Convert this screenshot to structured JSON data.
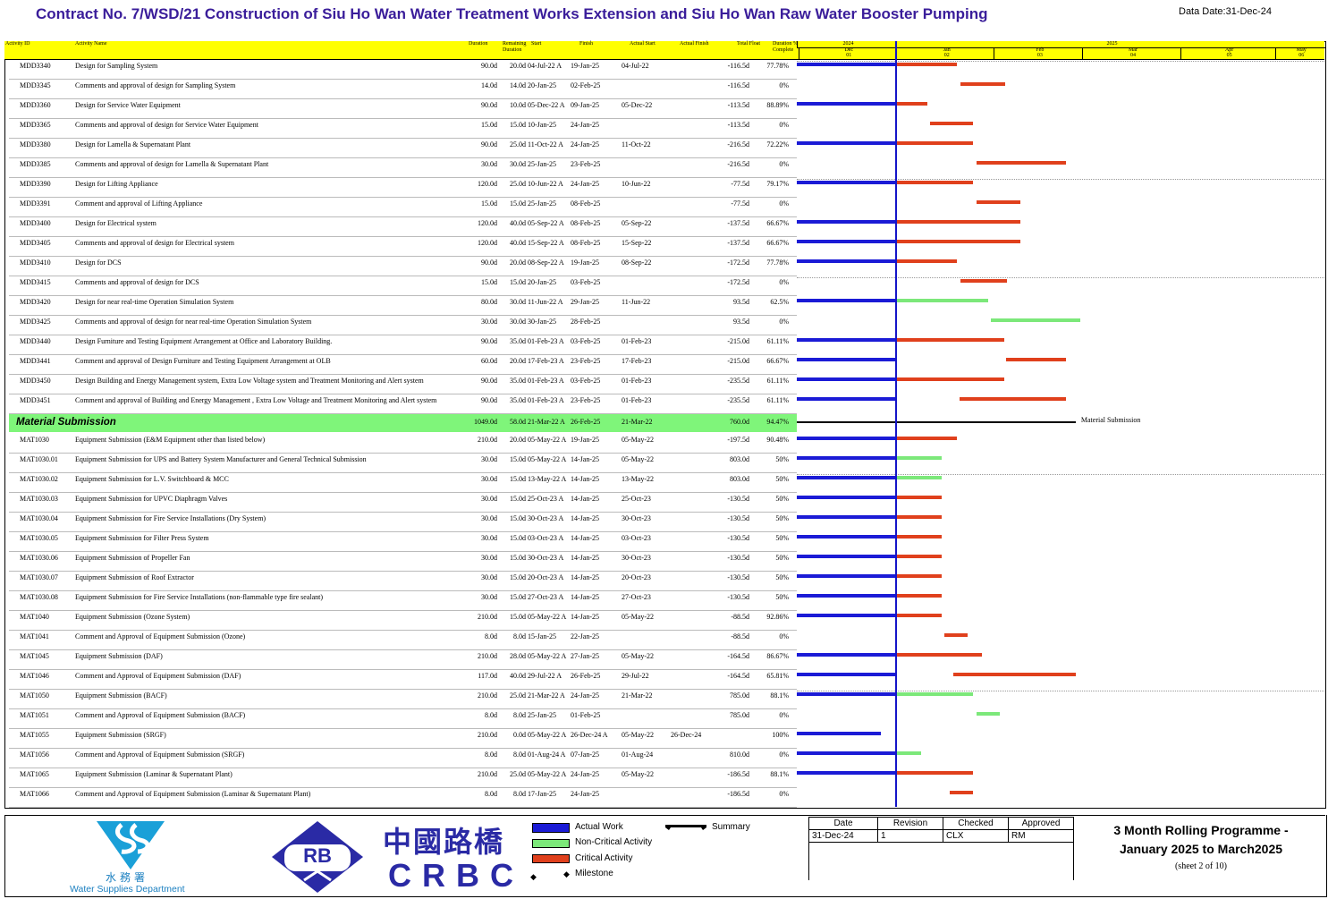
{
  "title": "Contract No. 7/WSD/21 Construction of Siu Ho Wan Water Treatment Works Extension and Siu Ho Wan Raw Water Booster Pumping",
  "data_date": "Data Date:31-Dec-24",
  "columns": {
    "activity_id": "Activity ID",
    "activity_name": "Activity Name",
    "duration": "Duration",
    "remaining": "Remaining Duration",
    "start": "Start",
    "finish": "Finish",
    "actual_start": "Actual Start",
    "actual_finish": "Actual Finish",
    "total_float": "Total Float",
    "complete": "Duration % Complete"
  },
  "timescale": {
    "years": [
      "2024",
      "2025"
    ],
    "months": [
      "Dec",
      "Jan",
      "Feb",
      "Mar",
      "Apr",
      "May"
    ],
    "periods": [
      "01",
      "02",
      "03",
      "04",
      "05",
      "06"
    ]
  },
  "colors": {
    "actual": "#1b1bd6",
    "critical": "#e0401c",
    "non_critical": "#7ce87a",
    "wbs_band": "#7ff57a",
    "header": "#ffff00",
    "title": "#3a1d9a"
  },
  "rows": [
    {
      "id": "MDD3340",
      "name": "Design for Sampling System",
      "dur": "90.0d",
      "rem": "20.0d",
      "start": "04-Jul-22 A",
      "finish": "19-Jan-25",
      "astart": "04-Jul-22",
      "afinish": "",
      "tf": "-116.5d",
      "pct": "77.78%",
      "actual": 1,
      "t_start": 0.0,
      "t_end": 0.63,
      "type": "crit"
    },
    {
      "id": "MDD3345",
      "name": "Comments and approval of design for Sampling System",
      "dur": "14.0d",
      "rem": "14.0d",
      "start": "20-Jan-25",
      "finish": "02-Feb-25",
      "astart": "",
      "afinish": "",
      "tf": "-116.5d",
      "pct": "0%",
      "actual": 0,
      "t_start": 0.67,
      "t_end": 1.13,
      "type": "crit"
    },
    {
      "id": "MDD3360",
      "name": "Design for Service Water Equipment",
      "dur": "90.0d",
      "rem": "10.0d",
      "start": "05-Dec-22 A",
      "finish": "09-Jan-25",
      "astart": "05-Dec-22",
      "afinish": "",
      "tf": "-113.5d",
      "pct": "88.89%",
      "actual": 1,
      "t_start": 0.0,
      "t_end": 0.32,
      "type": "crit"
    },
    {
      "id": "MDD3365",
      "name": "Comments and approval of design for Service Water Equipment",
      "dur": "15.0d",
      "rem": "15.0d",
      "start": "10-Jan-25",
      "finish": "24-Jan-25",
      "astart": "",
      "afinish": "",
      "tf": "-113.5d",
      "pct": "0%",
      "actual": 0,
      "t_start": 0.35,
      "t_end": 0.8,
      "type": "crit"
    },
    {
      "id": "MDD3380",
      "name": "Design for Lamella & Supernatant Plant",
      "dur": "90.0d",
      "rem": "25.0d",
      "start": "11-Oct-22 A",
      "finish": "24-Jan-25",
      "astart": "11-Oct-22",
      "afinish": "",
      "tf": "-216.5d",
      "pct": "72.22%",
      "actual": 1,
      "t_start": 0.0,
      "t_end": 0.8,
      "type": "crit"
    },
    {
      "id": "MDD3385",
      "name": "Comments and approval of design for Lamella & Supernatant Plant",
      "dur": "30.0d",
      "rem": "30.0d",
      "start": "25-Jan-25",
      "finish": "23-Feb-25",
      "astart": "",
      "afinish": "",
      "tf": "-216.5d",
      "pct": "0%",
      "actual": 0,
      "t_start": 0.83,
      "t_end": 1.76,
      "type": "crit"
    },
    {
      "id": "MDD3390",
      "name": "Design for Lifting Appliance",
      "dur": "120.0d",
      "rem": "25.0d",
      "start": "10-Jun-22 A",
      "finish": "24-Jan-25",
      "astart": "10-Jun-22",
      "afinish": "",
      "tf": "-77.5d",
      "pct": "79.17%",
      "actual": 1,
      "t_start": 0.0,
      "t_end": 0.8,
      "type": "crit"
    },
    {
      "id": "MDD3391",
      "name": "Comment and approval of Lifting Appliance",
      "dur": "15.0d",
      "rem": "15.0d",
      "start": "25-Jan-25",
      "finish": "08-Feb-25",
      "astart": "",
      "afinish": "",
      "tf": "-77.5d",
      "pct": "0%",
      "actual": 0,
      "t_start": 0.83,
      "t_end": 1.29,
      "type": "crit"
    },
    {
      "id": "MDD3400",
      "name": "Design for Electrical system",
      "dur": "120.0d",
      "rem": "40.0d",
      "start": "05-Sep-22 A",
      "finish": "08-Feb-25",
      "astart": "05-Sep-22",
      "afinish": "",
      "tf": "-137.5d",
      "pct": "66.67%",
      "actual": 1,
      "t_start": 0.0,
      "t_end": 1.29,
      "type": "crit"
    },
    {
      "id": "MDD3405",
      "name": "Comments and approval of design for Electrical system",
      "dur": "120.0d",
      "rem": "40.0d",
      "start": "15-Sep-22 A",
      "finish": "08-Feb-25",
      "astart": "15-Sep-22",
      "afinish": "",
      "tf": "-137.5d",
      "pct": "66.67%",
      "actual": 1,
      "t_start": 0.0,
      "t_end": 1.29,
      "type": "crit"
    },
    {
      "id": "MDD3410",
      "name": "Design for DCS",
      "dur": "90.0d",
      "rem": "20.0d",
      "start": "08-Sep-22 A",
      "finish": "19-Jan-25",
      "astart": "08-Sep-22",
      "afinish": "",
      "tf": "-172.5d",
      "pct": "77.78%",
      "actual": 1,
      "t_start": 0.0,
      "t_end": 0.63,
      "type": "crit"
    },
    {
      "id": "MDD3415",
      "name": "Comments and approval of design for DCS",
      "dur": "15.0d",
      "rem": "15.0d",
      "start": "20-Jan-25",
      "finish": "03-Feb-25",
      "astart": "",
      "afinish": "",
      "tf": "-172.5d",
      "pct": "0%",
      "actual": 0,
      "t_start": 0.67,
      "t_end": 1.15,
      "type": "crit"
    },
    {
      "id": "MDD3420",
      "name": "Design for near real-time Operation Simulation System",
      "dur": "80.0d",
      "rem": "30.0d",
      "start": "11-Jun-22 A",
      "finish": "29-Jan-25",
      "astart": "11-Jun-22",
      "afinish": "",
      "tf": "93.5d",
      "pct": "62.5%",
      "actual": 1,
      "t_start": 0.0,
      "t_end": 0.95,
      "type": "noncrit"
    },
    {
      "id": "MDD3425",
      "name": "Comments and approval of design for near real-time Operation Simulation System",
      "dur": "30.0d",
      "rem": "30.0d",
      "start": "30-Jan-25",
      "finish": "28-Feb-25",
      "astart": "",
      "afinish": "",
      "tf": "93.5d",
      "pct": "0%",
      "actual": 0,
      "t_start": 0.98,
      "t_end": 1.91,
      "type": "noncrit"
    },
    {
      "id": "MDD3440",
      "name": "Design Furniture and Testing Equipment Arrangement at Office and Laboratory Building.",
      "dur": "90.0d",
      "rem": "35.0d",
      "start": "01-Feb-23 A",
      "finish": "03-Feb-25",
      "astart": "01-Feb-23",
      "afinish": "",
      "tf": "-215.0d",
      "pct": "61.11%",
      "actual": 1,
      "t_start": 0.0,
      "t_end": 1.12,
      "type": "crit"
    },
    {
      "id": "MDD3441",
      "name": "Comment and approval of Design Furniture and Testing Equipment Arrangement at OLB",
      "dur": "60.0d",
      "rem": "20.0d",
      "start": "17-Feb-23 A",
      "finish": "23-Feb-25",
      "astart": "17-Feb-23",
      "afinish": "",
      "tf": "-215.0d",
      "pct": "66.67%",
      "actual": 1,
      "t_start": 1.14,
      "t_end": 1.76,
      "type": "crit"
    },
    {
      "id": "MDD3450",
      "name": "Design Building and Energy Management system, Extra Low Voltage system and Treatment Monitoring and Alert system",
      "dur": "90.0d",
      "rem": "35.0d",
      "start": "01-Feb-23 A",
      "finish": "03-Feb-25",
      "astart": "01-Feb-23",
      "afinish": "",
      "tf": "-235.5d",
      "pct": "61.11%",
      "actual": 1,
      "t_start": 0.0,
      "t_end": 1.12,
      "type": "crit"
    },
    {
      "id": "MDD3451",
      "name": "Comment and approval of Building and Energy Management , Extra Low Voltage and Treatment Monitoring and Alert system",
      "dur": "90.0d",
      "rem": "35.0d",
      "start": "01-Feb-23 A",
      "finish": "23-Feb-25",
      "astart": "01-Feb-23",
      "afinish": "",
      "tf": "-235.5d",
      "pct": "61.11%",
      "actual": 1,
      "t_start": 0.66,
      "t_end": 1.76,
      "type": "crit"
    },
    {
      "wbs": true,
      "name": "Material Submission",
      "dur": "1049.0d",
      "rem": "58.0d",
      "start": "21-Mar-22 A",
      "finish": "26-Feb-25",
      "astart": "21-Mar-22",
      "afinish": "",
      "tf": "760.0d",
      "pct": "94.47%",
      "label": "Material Submission"
    },
    {
      "id": "MAT1030",
      "name": "Equipment Submission (E&M Equipment other than listed below)",
      "dur": "210.0d",
      "rem": "20.0d",
      "start": "05-May-22 A",
      "finish": "19-Jan-25",
      "astart": "05-May-22",
      "afinish": "",
      "tf": "-197.5d",
      "pct": "90.48%",
      "actual": 1,
      "t_start": 0.0,
      "t_end": 0.63,
      "type": "crit"
    },
    {
      "id": "MAT1030.01",
      "name": "Equipment Submission for UPS and Battery System Manufacturer and General Technical Submission",
      "dur": "30.0d",
      "rem": "15.0d",
      "start": "05-May-22 A",
      "finish": "14-Jan-25",
      "astart": "05-May-22",
      "afinish": "",
      "tf": "803.0d",
      "pct": "50%",
      "actual": 1,
      "t_start": 0.0,
      "t_end": 0.47,
      "type": "noncrit"
    },
    {
      "id": "MAT1030.02",
      "name": "Equipment Submission for L.V. Switchboard & MCC",
      "dur": "30.0d",
      "rem": "15.0d",
      "start": "13-May-22 A",
      "finish": "14-Jan-25",
      "astart": "13-May-22",
      "afinish": "",
      "tf": "803.0d",
      "pct": "50%",
      "actual": 1,
      "t_start": 0.0,
      "t_end": 0.47,
      "type": "noncrit"
    },
    {
      "id": "MAT1030.03",
      "name": "Equipment Submission for UPVC Diaphragm Valves",
      "dur": "30.0d",
      "rem": "15.0d",
      "start": "25-Oct-23 A",
      "finish": "14-Jan-25",
      "astart": "25-Oct-23",
      "afinish": "",
      "tf": "-130.5d",
      "pct": "50%",
      "actual": 1,
      "t_start": 0.0,
      "t_end": 0.47,
      "type": "crit"
    },
    {
      "id": "MAT1030.04",
      "name": "Equipment Submission for Fire Service Installations (Dry System)",
      "dur": "30.0d",
      "rem": "15.0d",
      "start": "30-Oct-23 A",
      "finish": "14-Jan-25",
      "astart": "30-Oct-23",
      "afinish": "",
      "tf": "-130.5d",
      "pct": "50%",
      "actual": 1,
      "t_start": 0.0,
      "t_end": 0.47,
      "type": "crit"
    },
    {
      "id": "MAT1030.05",
      "name": "Equipment Submission for Filter Press System",
      "dur": "30.0d",
      "rem": "15.0d",
      "start": "03-Oct-23 A",
      "finish": "14-Jan-25",
      "astart": "03-Oct-23",
      "afinish": "",
      "tf": "-130.5d",
      "pct": "50%",
      "actual": 1,
      "t_start": 0.0,
      "t_end": 0.47,
      "type": "crit"
    },
    {
      "id": "MAT1030.06",
      "name": "Equipment Submission of Propeller Fan",
      "dur": "30.0d",
      "rem": "15.0d",
      "start": "30-Oct-23 A",
      "finish": "14-Jan-25",
      "astart": "30-Oct-23",
      "afinish": "",
      "tf": "-130.5d",
      "pct": "50%",
      "actual": 1,
      "t_start": 0.0,
      "t_end": 0.47,
      "type": "crit"
    },
    {
      "id": "MAT1030.07",
      "name": "Equipment Submission of Roof Extractor",
      "dur": "30.0d",
      "rem": "15.0d",
      "start": "20-Oct-23 A",
      "finish": "14-Jan-25",
      "astart": "20-Oct-23",
      "afinish": "",
      "tf": "-130.5d",
      "pct": "50%",
      "actual": 1,
      "t_start": 0.0,
      "t_end": 0.47,
      "type": "crit"
    },
    {
      "id": "MAT1030.08",
      "name": "Equipment Submission for Fire Service Installations (non-flammable type fire sealant)",
      "dur": "30.0d",
      "rem": "15.0d",
      "start": "27-Oct-23 A",
      "finish": "14-Jan-25",
      "astart": "27-Oct-23",
      "afinish": "",
      "tf": "-130.5d",
      "pct": "50%",
      "actual": 1,
      "t_start": 0.0,
      "t_end": 0.47,
      "type": "crit"
    },
    {
      "id": "MAT1040",
      "name": "Equipment Submission (Ozone System)",
      "dur": "210.0d",
      "rem": "15.0d",
      "start": "05-May-22 A",
      "finish": "14-Jan-25",
      "astart": "05-May-22",
      "afinish": "",
      "tf": "-88.5d",
      "pct": "92.86%",
      "actual": 1,
      "t_start": 0.0,
      "t_end": 0.47,
      "type": "crit"
    },
    {
      "id": "MAT1041",
      "name": "Comment and Approval of Equipment Submission (Ozone)",
      "dur": "8.0d",
      "rem": "8.0d",
      "start": "15-Jan-25",
      "finish": "22-Jan-25",
      "astart": "",
      "afinish": "",
      "tf": "-88.5d",
      "pct": "0%",
      "actual": 0,
      "t_start": 0.5,
      "t_end": 0.74,
      "type": "crit"
    },
    {
      "id": "MAT1045",
      "name": "Equipment Submission (DAF)",
      "dur": "210.0d",
      "rem": "28.0d",
      "start": "05-May-22 A",
      "finish": "27-Jan-25",
      "astart": "05-May-22",
      "afinish": "",
      "tf": "-164.5d",
      "pct": "86.67%",
      "actual": 1,
      "t_start": 0.0,
      "t_end": 0.89,
      "type": "crit"
    },
    {
      "id": "MAT1046",
      "name": "Comment and Approval of Equipment Submission (DAF)",
      "dur": "117.0d",
      "rem": "40.0d",
      "start": "29-Jul-22 A",
      "finish": "26-Feb-25",
      "astart": "29-Jul-22",
      "afinish": "",
      "tf": "-164.5d",
      "pct": "65.81%",
      "actual": 1,
      "t_start": 0.59,
      "t_end": 1.86,
      "type": "crit"
    },
    {
      "id": "MAT1050",
      "name": "Equipment Submission (BACF)",
      "dur": "210.0d",
      "rem": "25.0d",
      "start": "21-Mar-22 A",
      "finish": "24-Jan-25",
      "astart": "21-Mar-22",
      "afinish": "",
      "tf": "785.0d",
      "pct": "88.1%",
      "actual": 1,
      "t_start": 0.0,
      "t_end": 0.8,
      "type": "noncrit"
    },
    {
      "id": "MAT1051",
      "name": "Comment and Approval of Equipment Submission (BACF)",
      "dur": "8.0d",
      "rem": "8.0d",
      "start": "25-Jan-25",
      "finish": "01-Feb-25",
      "astart": "",
      "afinish": "",
      "tf": "785.0d",
      "pct": "0%",
      "actual": 0,
      "t_start": 0.83,
      "t_end": 1.07,
      "type": "noncrit"
    },
    {
      "id": "MAT1055",
      "name": "Equipment Submission (SRGF)",
      "dur": "210.0d",
      "rem": "0.0d",
      "start": "05-May-22 A",
      "finish": "26-Dec-24 A",
      "astart": "05-May-22",
      "afinish": "26-Dec-24",
      "tf": "",
      "pct": "100%",
      "actual": 1,
      "t_start": 0,
      "t_end": 0,
      "type": "none",
      "actual_end": -0.16
    },
    {
      "id": "MAT1056",
      "name": "Comment and Approval of Equipment Submission (SRGF)",
      "dur": "8.0d",
      "rem": "8.0d",
      "start": "01-Aug-24 A",
      "finish": "07-Jan-25",
      "astart": "01-Aug-24",
      "afinish": "",
      "tf": "810.0d",
      "pct": "0%",
      "actual": 1,
      "t_start": 0.0,
      "t_end": 0.26,
      "type": "noncrit"
    },
    {
      "id": "MAT1065",
      "name": "Equipment Submission (Laminar & Supernatant Plant)",
      "dur": "210.0d",
      "rem": "25.0d",
      "start": "05-May-22 A",
      "finish": "24-Jan-25",
      "astart": "05-May-22",
      "afinish": "",
      "tf": "-186.5d",
      "pct": "88.1%",
      "actual": 1,
      "t_start": 0.0,
      "t_end": 0.8,
      "type": "crit"
    },
    {
      "id": "MAT1066",
      "name": "Comment and Approval of Equipment Submission (Laminar & Supernatant Plant)",
      "dur": "8.0d",
      "rem": "8.0d",
      "start": "17-Jan-25",
      "finish": "24-Jan-25",
      "astart": "",
      "afinish": "",
      "tf": "-186.5d",
      "pct": "0%",
      "actual": 0,
      "t_start": 0.56,
      "t_end": 0.8,
      "type": "crit"
    }
  ],
  "legend": {
    "actual": "Actual Work",
    "noncrit": "Non-Critical Activity",
    "crit": "Critical Activity",
    "milestone": "Milestone",
    "summary": "Summary"
  },
  "revision": {
    "headers": [
      "Date",
      "Revision",
      "Checked",
      "Approved"
    ],
    "values": [
      "31-Dec-24",
      "1",
      "CLX",
      "RM"
    ]
  },
  "report_title_1": "3 Month Rolling Programme -",
  "report_title_2": "January 2025 to March2025",
  "sheet": "(sheet 2 of 10)",
  "wsd_chinese": "水務署",
  "wsd_english": "Water Supplies Department",
  "crbc_chinese": "中國路橋",
  "crbc_english": "CRBC",
  "rb_text": "RB"
}
